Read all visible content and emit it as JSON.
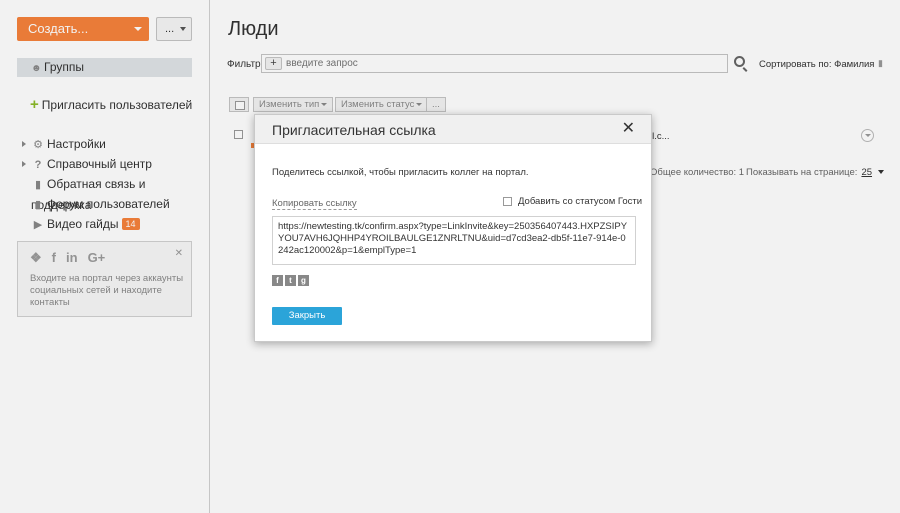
{
  "sidebar": {
    "create_label": "Создать...",
    "more_label": "...",
    "groups_label": "Группы",
    "invite_label": "Пригласить пользователей",
    "menu": [
      {
        "label": "Настройки",
        "icon": "gear-icon"
      },
      {
        "label": "Справочный центр",
        "icon": "question-icon"
      },
      {
        "label": "Обратная связь и поддержка",
        "icon": "chat-icon"
      },
      {
        "label": "Форум пользователей",
        "icon": "forum-icon"
      },
      {
        "label": "Видео гайды",
        "icon": "video-icon",
        "badge": "14"
      }
    ],
    "social_text": "Входите на портал через аккаунты социальных сетей и находите контакты",
    "social_icons": [
      "twitter-icon",
      "facebook-icon",
      "linkedin-icon",
      "googleplus-icon"
    ]
  },
  "main": {
    "title": "Люди",
    "filter_label": "Фильтр",
    "filter_placeholder": "введите запрос",
    "sort_label": "Сортировать по: Фамилия",
    "toolbar": {
      "change_type": "Изменить тип",
      "change_status": "Изменить статус",
      "more": "..."
    },
    "row_email_partial": "il.c...",
    "total_label": "Общее количество: 1",
    "per_page_label": "Показывать на странице:",
    "per_page_value": "25"
  },
  "dialog": {
    "title": "Пригласительная ссылка",
    "description": "Поделитесь ссылкой, чтобы пригласить коллег на портал.",
    "copy_link": "Копировать ссылку",
    "guest_label": "Добавить со статусом Гости",
    "link": "https://newtesting.tk/confirm.aspx?type=LinkInvite&key=250356407443.HXPZSIPYYOU7AVH6JQHHP4YROILBAULGE1ZNRLTNU&uid=d7cd3ea2-db5f-11e7-914e-0242ac120002&p=1&emplType=1",
    "close_label": "Закрыть"
  },
  "colors": {
    "accent_orange": "#f6823b",
    "button_blue": "#2ba4d9",
    "add_green": "#8cbb2a"
  }
}
